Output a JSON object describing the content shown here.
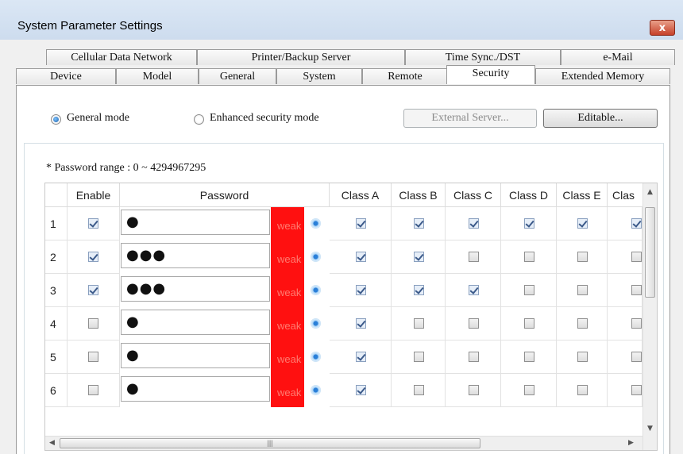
{
  "window": {
    "title": "System Parameter Settings",
    "close_glyph": "x"
  },
  "tabs_back": [
    {
      "label": "Cellular Data Network"
    },
    {
      "label": "Printer/Backup Server"
    },
    {
      "label": "Time Sync./DST"
    },
    {
      "label": "e-Mail"
    }
  ],
  "tabs_front": [
    {
      "label": "Device"
    },
    {
      "label": "Model"
    },
    {
      "label": "General"
    },
    {
      "label": "System"
    },
    {
      "label": "Remote"
    },
    {
      "label": "Security",
      "active": true
    },
    {
      "label": "Extended Memory"
    }
  ],
  "mode": {
    "general_label": "General mode",
    "enhanced_label": "Enhanced security mode",
    "selected": "General mode"
  },
  "buttons": {
    "external_server": "External Server...",
    "editable": "Editable..."
  },
  "note": "* Password range : 0 ~ 4294967295",
  "grid": {
    "columns": {
      "enable": "Enable",
      "password": "Password",
      "class_a": "Class A",
      "class_b": "Class B",
      "class_c": "Class C",
      "class_d": "Class D",
      "class_e": "Class E",
      "class_f_partial": "Clas"
    },
    "strength_label": "weak",
    "rows": [
      {
        "num": "1",
        "enable": true,
        "password_mask": "●",
        "classes": [
          true,
          true,
          true,
          true,
          true,
          true
        ]
      },
      {
        "num": "2",
        "enable": true,
        "password_mask": "●●●",
        "classes": [
          true,
          true,
          false,
          false,
          false,
          false
        ]
      },
      {
        "num": "3",
        "enable": true,
        "password_mask": "●●●",
        "classes": [
          true,
          true,
          true,
          false,
          false,
          false
        ]
      },
      {
        "num": "4",
        "enable": false,
        "password_mask": "●",
        "classes": [
          true,
          false,
          false,
          false,
          false,
          false
        ]
      },
      {
        "num": "5",
        "enable": false,
        "password_mask": "●",
        "classes": [
          true,
          false,
          false,
          false,
          false,
          false
        ]
      },
      {
        "num": "6",
        "enable": false,
        "password_mask": "●",
        "classes": [
          true,
          false,
          false,
          false,
          false,
          false
        ]
      }
    ]
  },
  "icons": {
    "eye": "eye-icon",
    "close": "close-icon"
  }
}
